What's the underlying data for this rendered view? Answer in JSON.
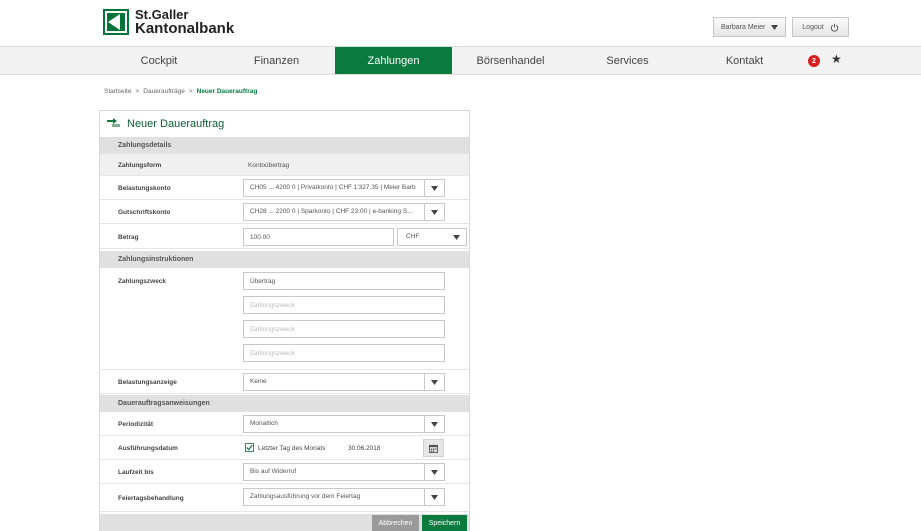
{
  "brand": {
    "line1": "St.Galler",
    "line2": "Kantonalbank",
    "color": "#00753a"
  },
  "user": {
    "name": "Barbara Meier"
  },
  "logout": {
    "label": "Logout"
  },
  "nav": {
    "items": [
      "Cockpit",
      "Finanzen",
      "Zahlungen",
      "Börsenhandel",
      "Services",
      "Kontakt"
    ],
    "active_index": 2,
    "badge_count": "2"
  },
  "breadcrumb": {
    "items": [
      "Startseite",
      "Daueraufträge",
      "Neuer Dauerauftrag"
    ],
    "separator": ">"
  },
  "form": {
    "title": "Neuer Dauerauftrag",
    "sections": {
      "details": "Zahlungsdetails",
      "instructions": "Zahlungsinstruktionen",
      "standing": "Dauerauftragsanweisungen"
    },
    "zahlungsform": {
      "label": "Zahlungsform",
      "value": "Kontoübertrag"
    },
    "belastungskonto": {
      "label": "Belastungskonto",
      "value": "CH05 ... 4200 0 | Privatkonto | CHF 1'327.35 | Meier Barb"
    },
    "gutschriftskonto": {
      "label": "Gutschriftskonto",
      "value": "CH28 ... 2200 0 | Sparkonto | CHF 23.00 | e-banking S..."
    },
    "betrag": {
      "label": "Betrag",
      "value": "100.00",
      "currency": "CHF"
    },
    "zahlungszweck": {
      "label": "Zahlungszweck",
      "value": "Übertrag",
      "placeholder": "Zahlungszweck"
    },
    "belastungsanzeige": {
      "label": "Belastungsanzeige",
      "value": "Keine"
    },
    "periodizitaet": {
      "label": "Periodizität",
      "value": "Monatlich"
    },
    "ausfuehrungsdatum": {
      "label": "Ausführungsdatum",
      "checkbox_label": "Letzter Tag des Monats",
      "checked": true,
      "date": "30.06.2018"
    },
    "laufzeit": {
      "label": "Laufzeit bis",
      "value": "Bis auf Widerruf"
    },
    "feiertag": {
      "label": "Feiertagsbehandlung",
      "value": "Zahlungsausführung vor dem Feiertag"
    },
    "cancel_label": "Abbrechen",
    "save_label": "Speichern"
  }
}
